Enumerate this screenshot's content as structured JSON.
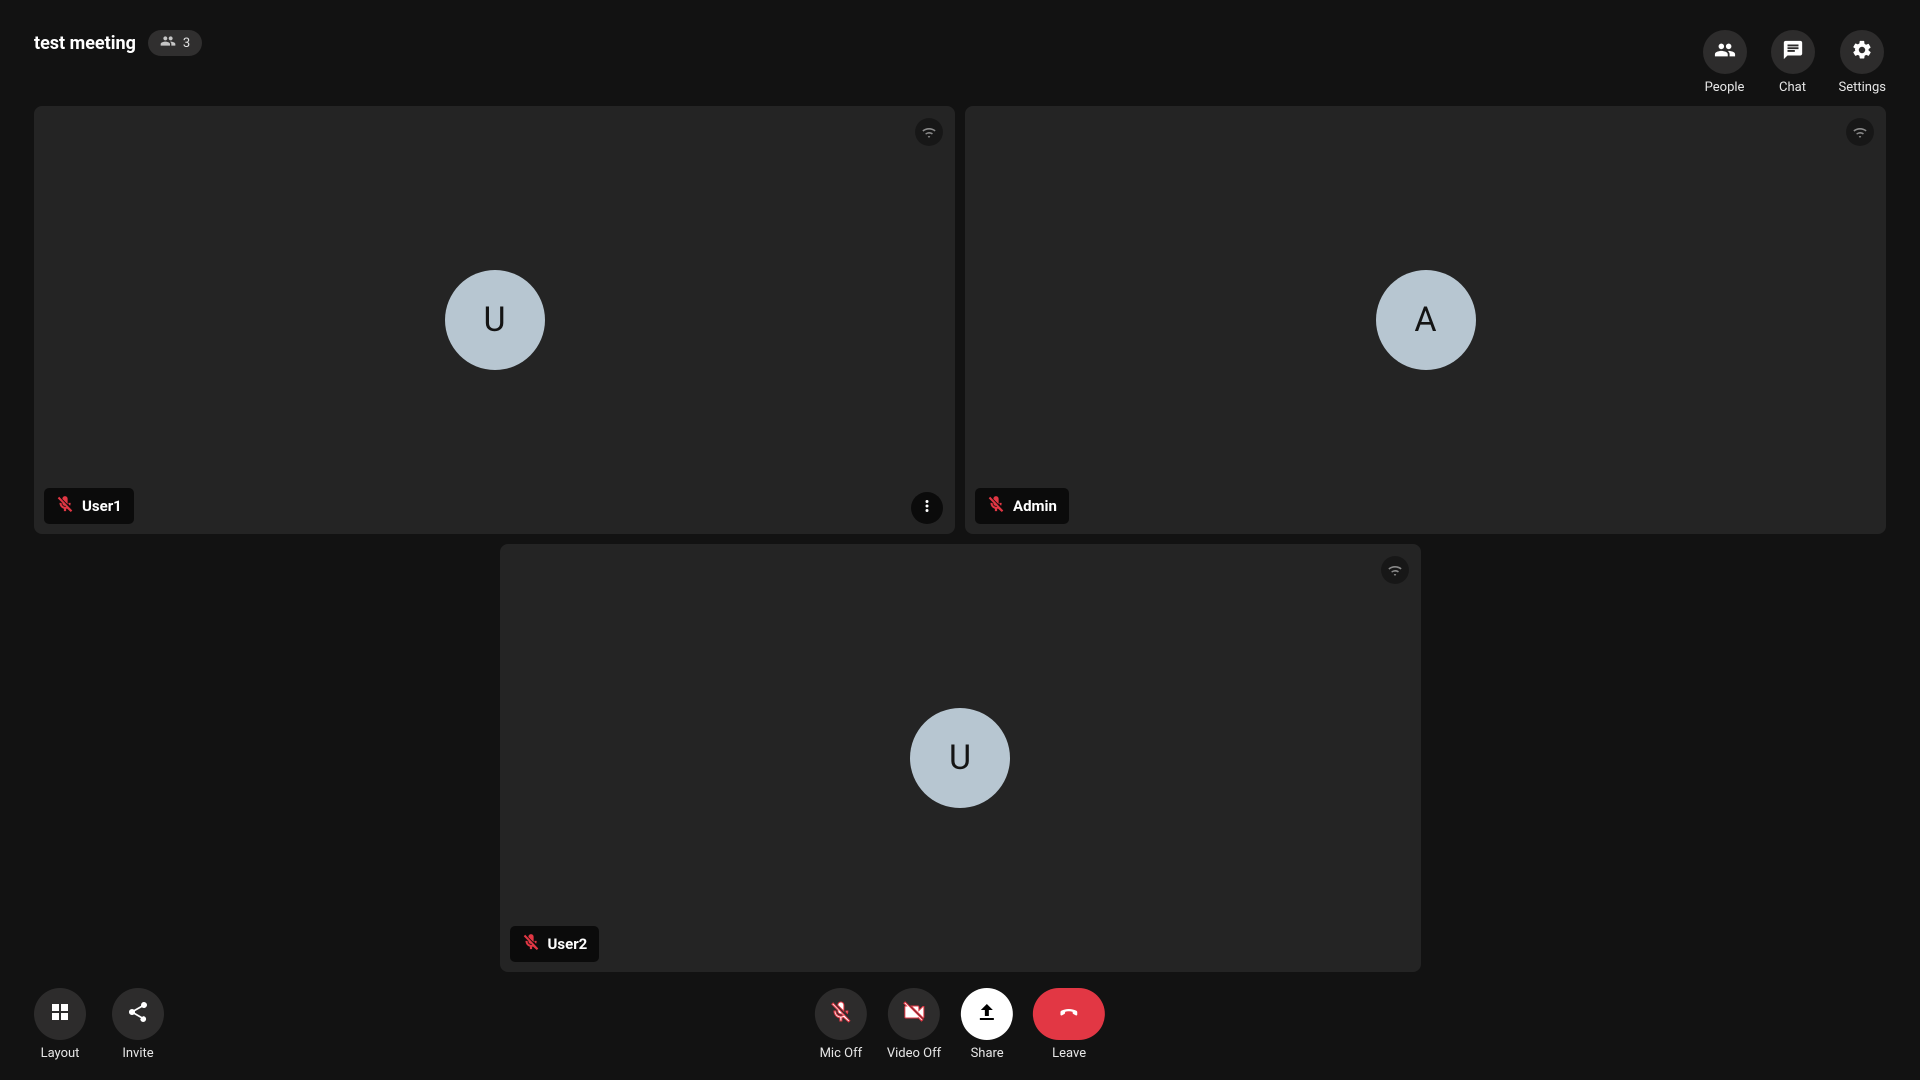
{
  "meeting": {
    "title": "test meeting",
    "participant_count": "3"
  },
  "header_buttons": {
    "people": {
      "label": "People"
    },
    "chat": {
      "label": "Chat"
    },
    "settings": {
      "label": "Settings"
    }
  },
  "participants": [
    {
      "name": "User1",
      "initial": "U",
      "muted": true,
      "show_more": true
    },
    {
      "name": "Admin",
      "initial": "A",
      "muted": true,
      "show_more": false
    },
    {
      "name": "User2",
      "initial": "U",
      "muted": true,
      "show_more": false
    }
  ],
  "controls": {
    "layout": {
      "label": "Layout"
    },
    "invite": {
      "label": "Invite"
    },
    "mic": {
      "label": "Mic Off"
    },
    "video": {
      "label": "Video Off"
    },
    "share": {
      "label": "Share"
    },
    "leave": {
      "label": "Leave"
    }
  }
}
